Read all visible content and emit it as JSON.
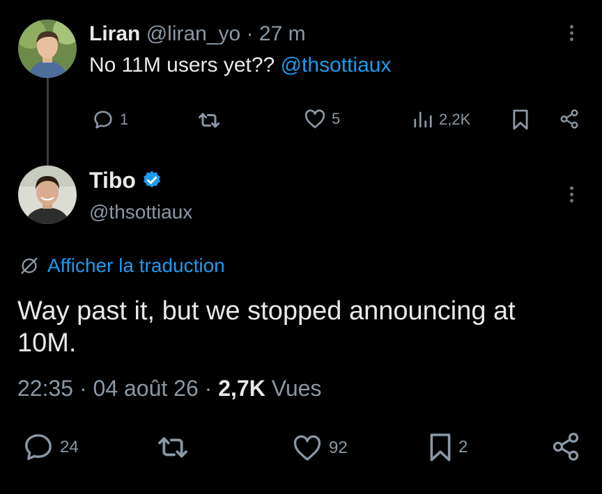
{
  "reply": {
    "author_name": "Liran",
    "author_handle": "@liran_yo",
    "separator": "·",
    "time": "27 m",
    "text": "No 11M users yet??",
    "mention": "@thsottiaux",
    "actions": {
      "replies": "1",
      "likes": "5",
      "views": "2,2K"
    }
  },
  "tweet": {
    "author_name": "Tibo",
    "author_handle": "@thsottiaux",
    "translate_label": "Afficher la traduction",
    "text": "Way past it, but we stopped announcing at 10M.",
    "time": "22:35",
    "separator": "·",
    "date": "04 août 26",
    "views_count": "2,7K",
    "views_label": "Vues",
    "actions": {
      "replies": "24",
      "likes": "92",
      "bookmarks": "2"
    }
  },
  "colors": {
    "background": "#000000",
    "text": "#e7e9ea",
    "muted": "#8b98a5",
    "accent": "#1d9bf0",
    "thread_line": "#3a3d41"
  },
  "icons": {
    "reply": "reply-bubble-icon",
    "retweet": "retweet-icon",
    "like": "heart-icon",
    "views": "bar-chart-icon",
    "bookmark": "bookmark-icon",
    "share": "share-icon",
    "more": "more-vertical-icon",
    "verified": "verified-badge-icon",
    "translate": "translate-icon"
  }
}
